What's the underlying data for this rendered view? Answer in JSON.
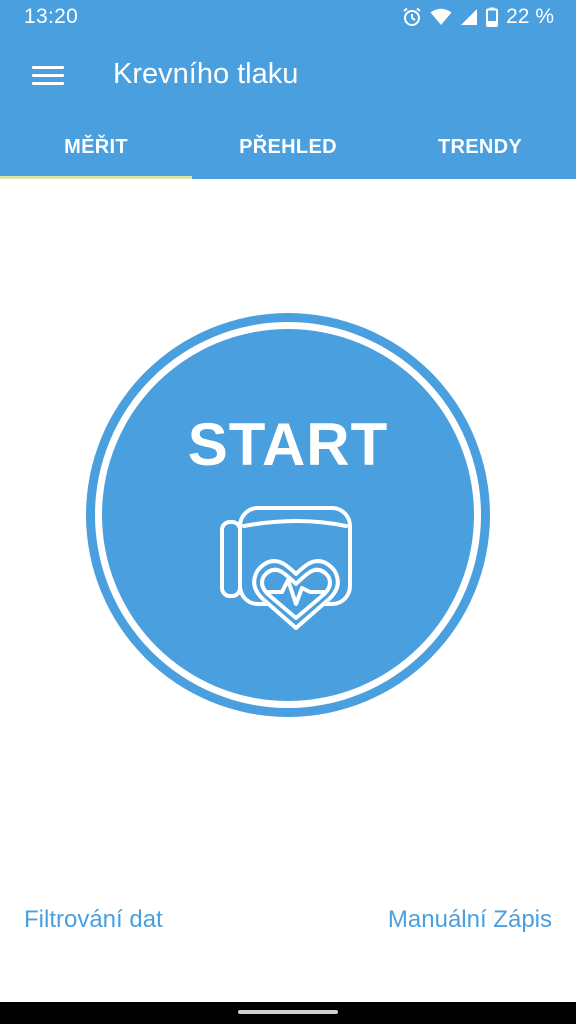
{
  "status_bar": {
    "time": "13:20",
    "battery_percent": "22 %",
    "icons": [
      "alarm-icon",
      "wifi-icon",
      "signal-icon",
      "battery-icon"
    ]
  },
  "app_bar": {
    "title": "Krevního tlaku",
    "menu_icon": "hamburger-menu-icon"
  },
  "tabs": [
    {
      "label": "MĚŘIT",
      "active": true
    },
    {
      "label": "PŘEHLED",
      "active": false
    },
    {
      "label": "TRENDY",
      "active": false
    }
  ],
  "main": {
    "start_label": "START",
    "icon": "blood-pressure-cuff-heart-icon"
  },
  "bottom_links": {
    "filter": "Filtrování dat",
    "manual_entry": "Manuální Zápis"
  },
  "colors": {
    "primary": "#4a9fdf",
    "tab_indicator": "#d6e7a8",
    "background": "#ffffff"
  }
}
